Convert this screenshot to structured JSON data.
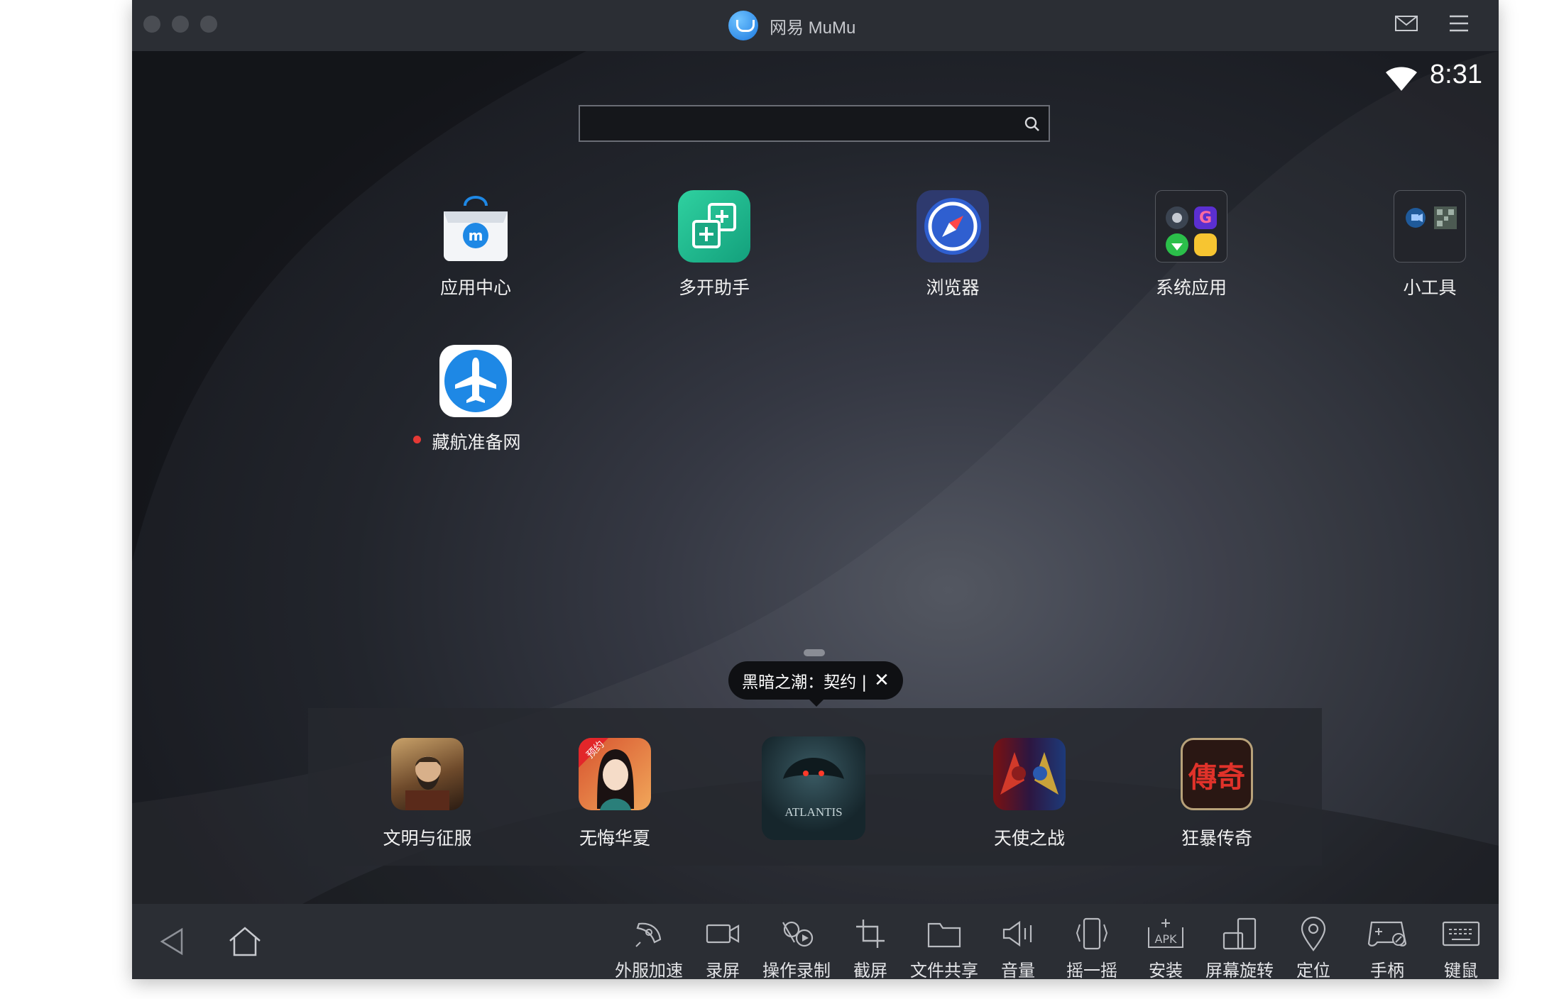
{
  "window": {
    "title": "网易 MuMu"
  },
  "status_bar": {
    "time": "8:31"
  },
  "search": {
    "placeholder": "",
    "value": ""
  },
  "desktop_apps": [
    {
      "label": "应用中心",
      "icon": "app-center-bag-icon",
      "notify_dot": false
    },
    {
      "label": "多开助手",
      "icon": "multi-open-icon",
      "notify_dot": false
    },
    {
      "label": "浏览器",
      "icon": "compass-browser-icon",
      "notify_dot": false
    },
    {
      "label": "系统应用",
      "icon": "system-apps-folder-icon",
      "notify_dot": false
    },
    {
      "label": "小工具",
      "icon": "tools-folder-icon",
      "notify_dot": false
    },
    {
      "label": "藏航准备网",
      "icon": "airplane-icon",
      "notify_dot": true
    }
  ],
  "dock": {
    "tooltip": "黑暗之潮：契约 |",
    "tooltip_close": "✕",
    "games": [
      {
        "label": "文明与征服",
        "icon": "civilization-conquest-icon"
      },
      {
        "label": "无悔华夏",
        "icon": "wuhui-huaxia-icon",
        "badge": "预约"
      },
      {
        "label": "",
        "icon": "atlantis-icon",
        "art_text": "ATLANTIS"
      },
      {
        "label": "天使之战",
        "icon": "angel-war-icon"
      },
      {
        "label": "狂暴传奇",
        "icon": "kuangbao-chuanqi-icon",
        "art_text": "傳奇"
      }
    ]
  },
  "toolbar": [
    {
      "label": "外服加速",
      "icon": "rocket-icon"
    },
    {
      "label": "录屏",
      "icon": "video-camera-icon"
    },
    {
      "label": "操作录制",
      "icon": "macro-record-icon"
    },
    {
      "label": "截屏",
      "icon": "crop-icon"
    },
    {
      "label": "文件共享",
      "icon": "folder-icon"
    },
    {
      "label": "音量",
      "icon": "speaker-icon"
    },
    {
      "label": "摇一摇",
      "icon": "shake-phone-icon"
    },
    {
      "label": "安装",
      "icon": "apk-install-icon"
    },
    {
      "label": "屏幕旋转",
      "icon": "rotate-screen-icon"
    },
    {
      "label": "定位",
      "icon": "location-pin-icon"
    },
    {
      "label": "手柄",
      "icon": "gamepad-icon"
    },
    {
      "label": "键鼠",
      "icon": "keyboard-icon"
    }
  ],
  "colors": {
    "titlebar": "#2b2e34",
    "bottombar": "#2b2e34",
    "notify_dot": "#e53935",
    "accent_blue": "#1e88e5"
  }
}
